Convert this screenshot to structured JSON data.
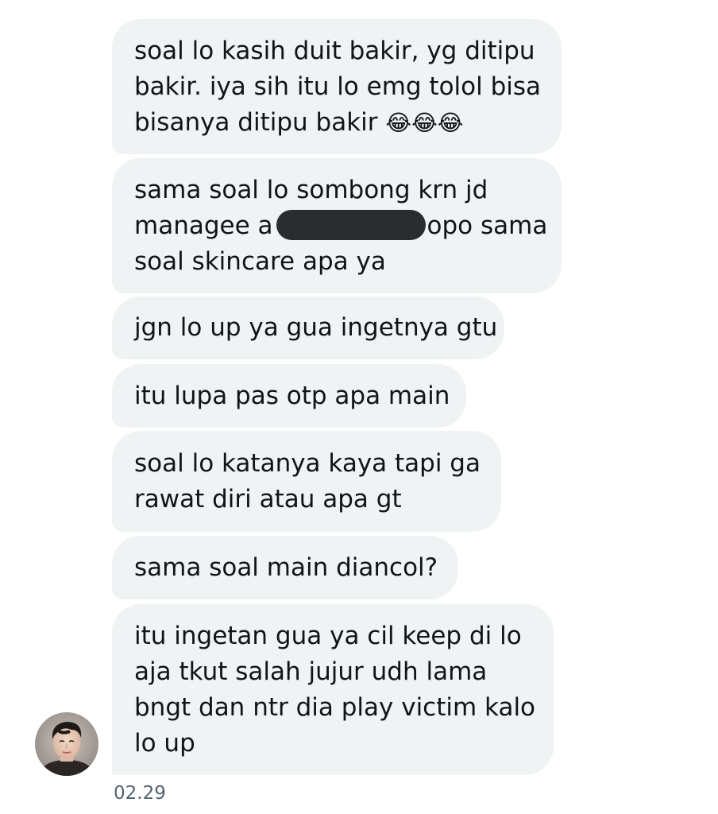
{
  "conversation": {
    "messages": [
      {
        "lines": [
          "soal lo kasih duit bakir, yg ditipu",
          "bakir. iya sih itu lo emg tolol bisa",
          "bisanya ditipu bakir"
        ],
        "emoji": "😂😂😂"
      },
      {
        "line1": "sama soal lo sombong krn jd",
        "line2_before": "managee a",
        "line2_after": "opo sama",
        "line3": "soal skincare apa ya"
      },
      {
        "lines": [
          "jgn lo up ya gua ingetnya gtu"
        ]
      },
      {
        "lines": [
          "itu lupa pas otp apa main"
        ]
      },
      {
        "lines": [
          "soal lo katanya kaya tapi ga",
          "rawat diri atau apa gt"
        ]
      },
      {
        "lines": [
          "sama soal main diancol?"
        ]
      },
      {
        "lines": [
          "itu ingetan gua ya cil keep di lo",
          "aja tkut salah jujur udh lama",
          "bngt dan ntr dia play victim kalo",
          "lo up"
        ]
      }
    ],
    "timestamp": "02.29"
  },
  "colors": {
    "bubble_bg": "#eff3f4",
    "text": "#0f1419",
    "timestamp": "#536471",
    "redaction": "#2a2d30"
  }
}
